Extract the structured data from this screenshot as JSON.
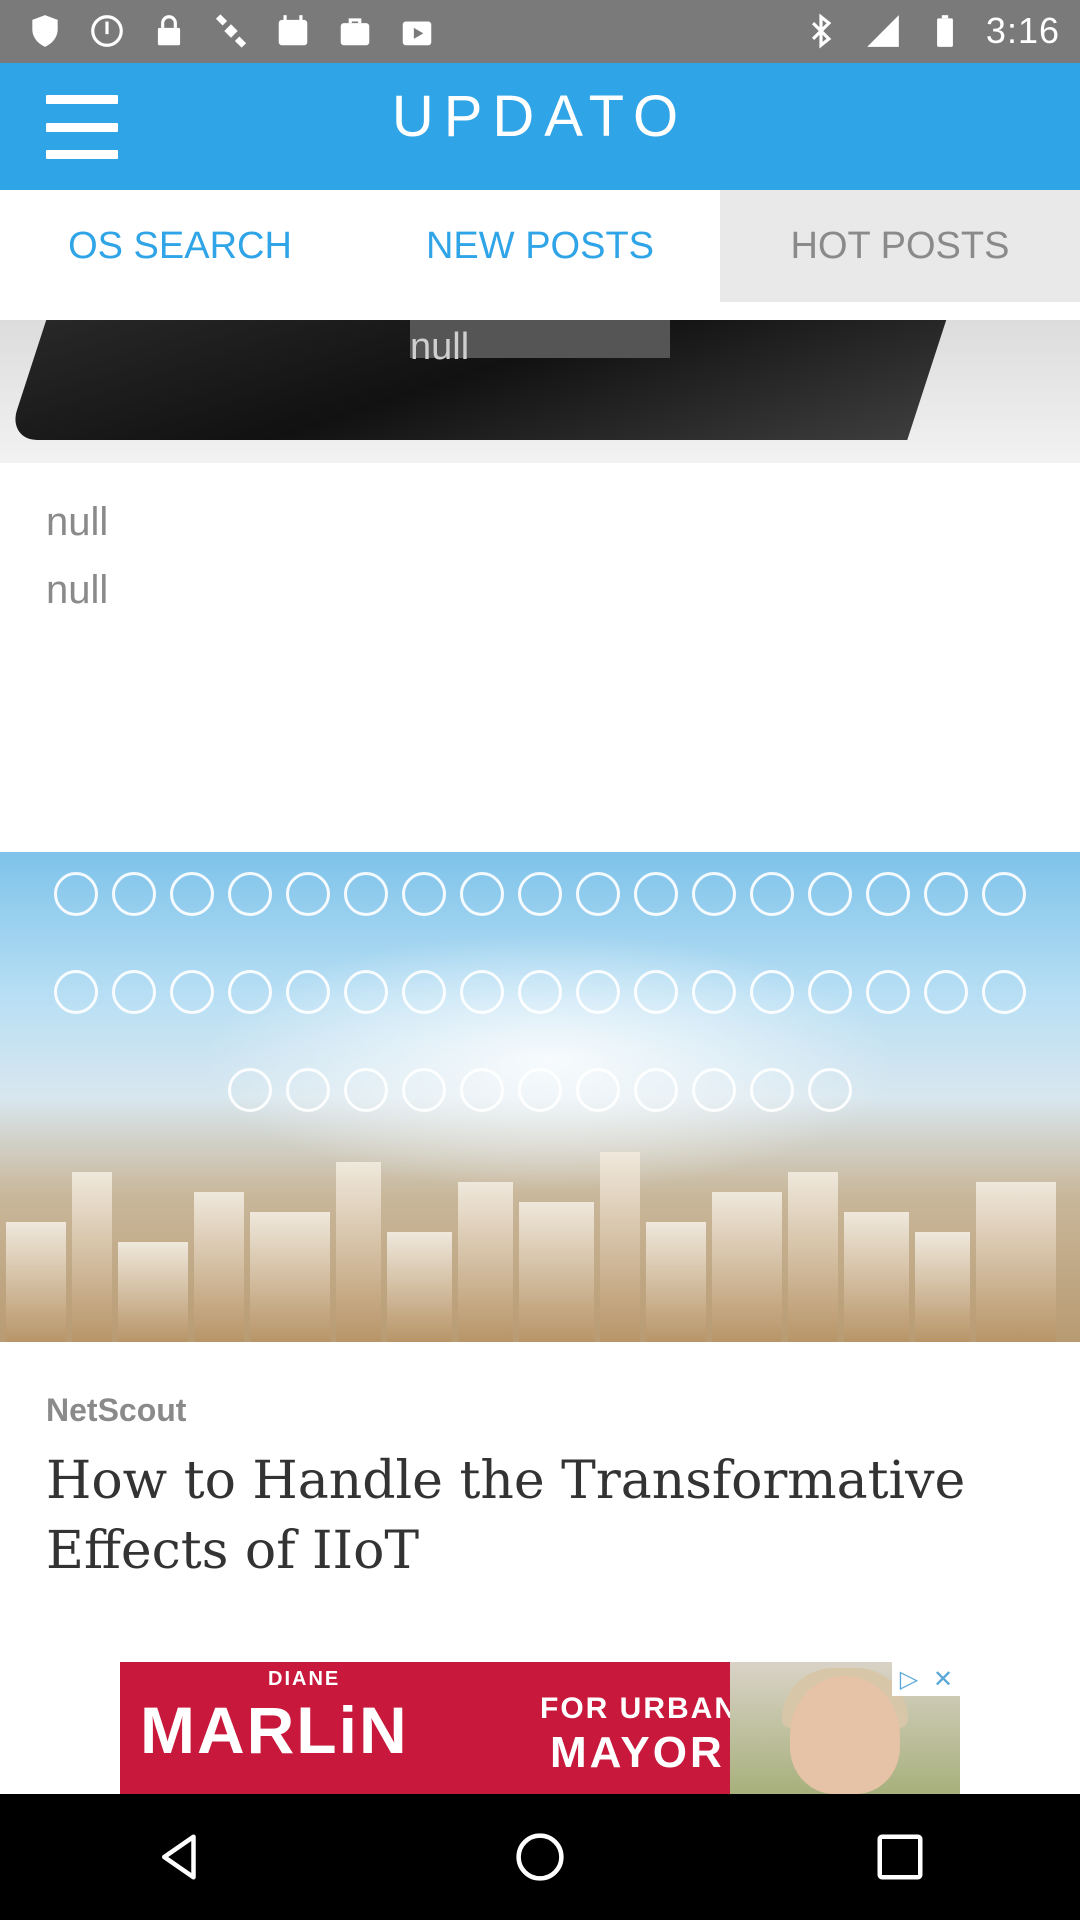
{
  "status_bar": {
    "time": "3:16",
    "icons": [
      "shield-icon",
      "dnd-icon",
      "lock-icon",
      "satellite-icon",
      "calendar-icon",
      "bag-icon",
      "play-store-icon",
      "bluetooth-icon",
      "signal-icon",
      "battery-icon"
    ]
  },
  "app_bar": {
    "brand": "UPDATO",
    "menu_icon": "menu-icon",
    "color": "#2fa4e7"
  },
  "tabs": [
    {
      "label": "OS SEARCH"
    },
    {
      "label": "NEW POSTS"
    },
    {
      "label": "HOT POSTS"
    }
  ],
  "feed": {
    "card1": {
      "image_caption": "null",
      "title": "null",
      "subtitle": "null"
    },
    "card2": {
      "source": "NetScout",
      "headline": "How to Handle the Transformative Effects of IIoT"
    }
  },
  "ad": {
    "top_text": "DIANE",
    "name": "MARLiN",
    "for_text": "FOR URBANA",
    "office": "MAYOR",
    "brand_color": "#c8193c"
  },
  "nav_bar": {
    "buttons": [
      "back-icon",
      "home-icon",
      "recents-icon"
    ]
  }
}
